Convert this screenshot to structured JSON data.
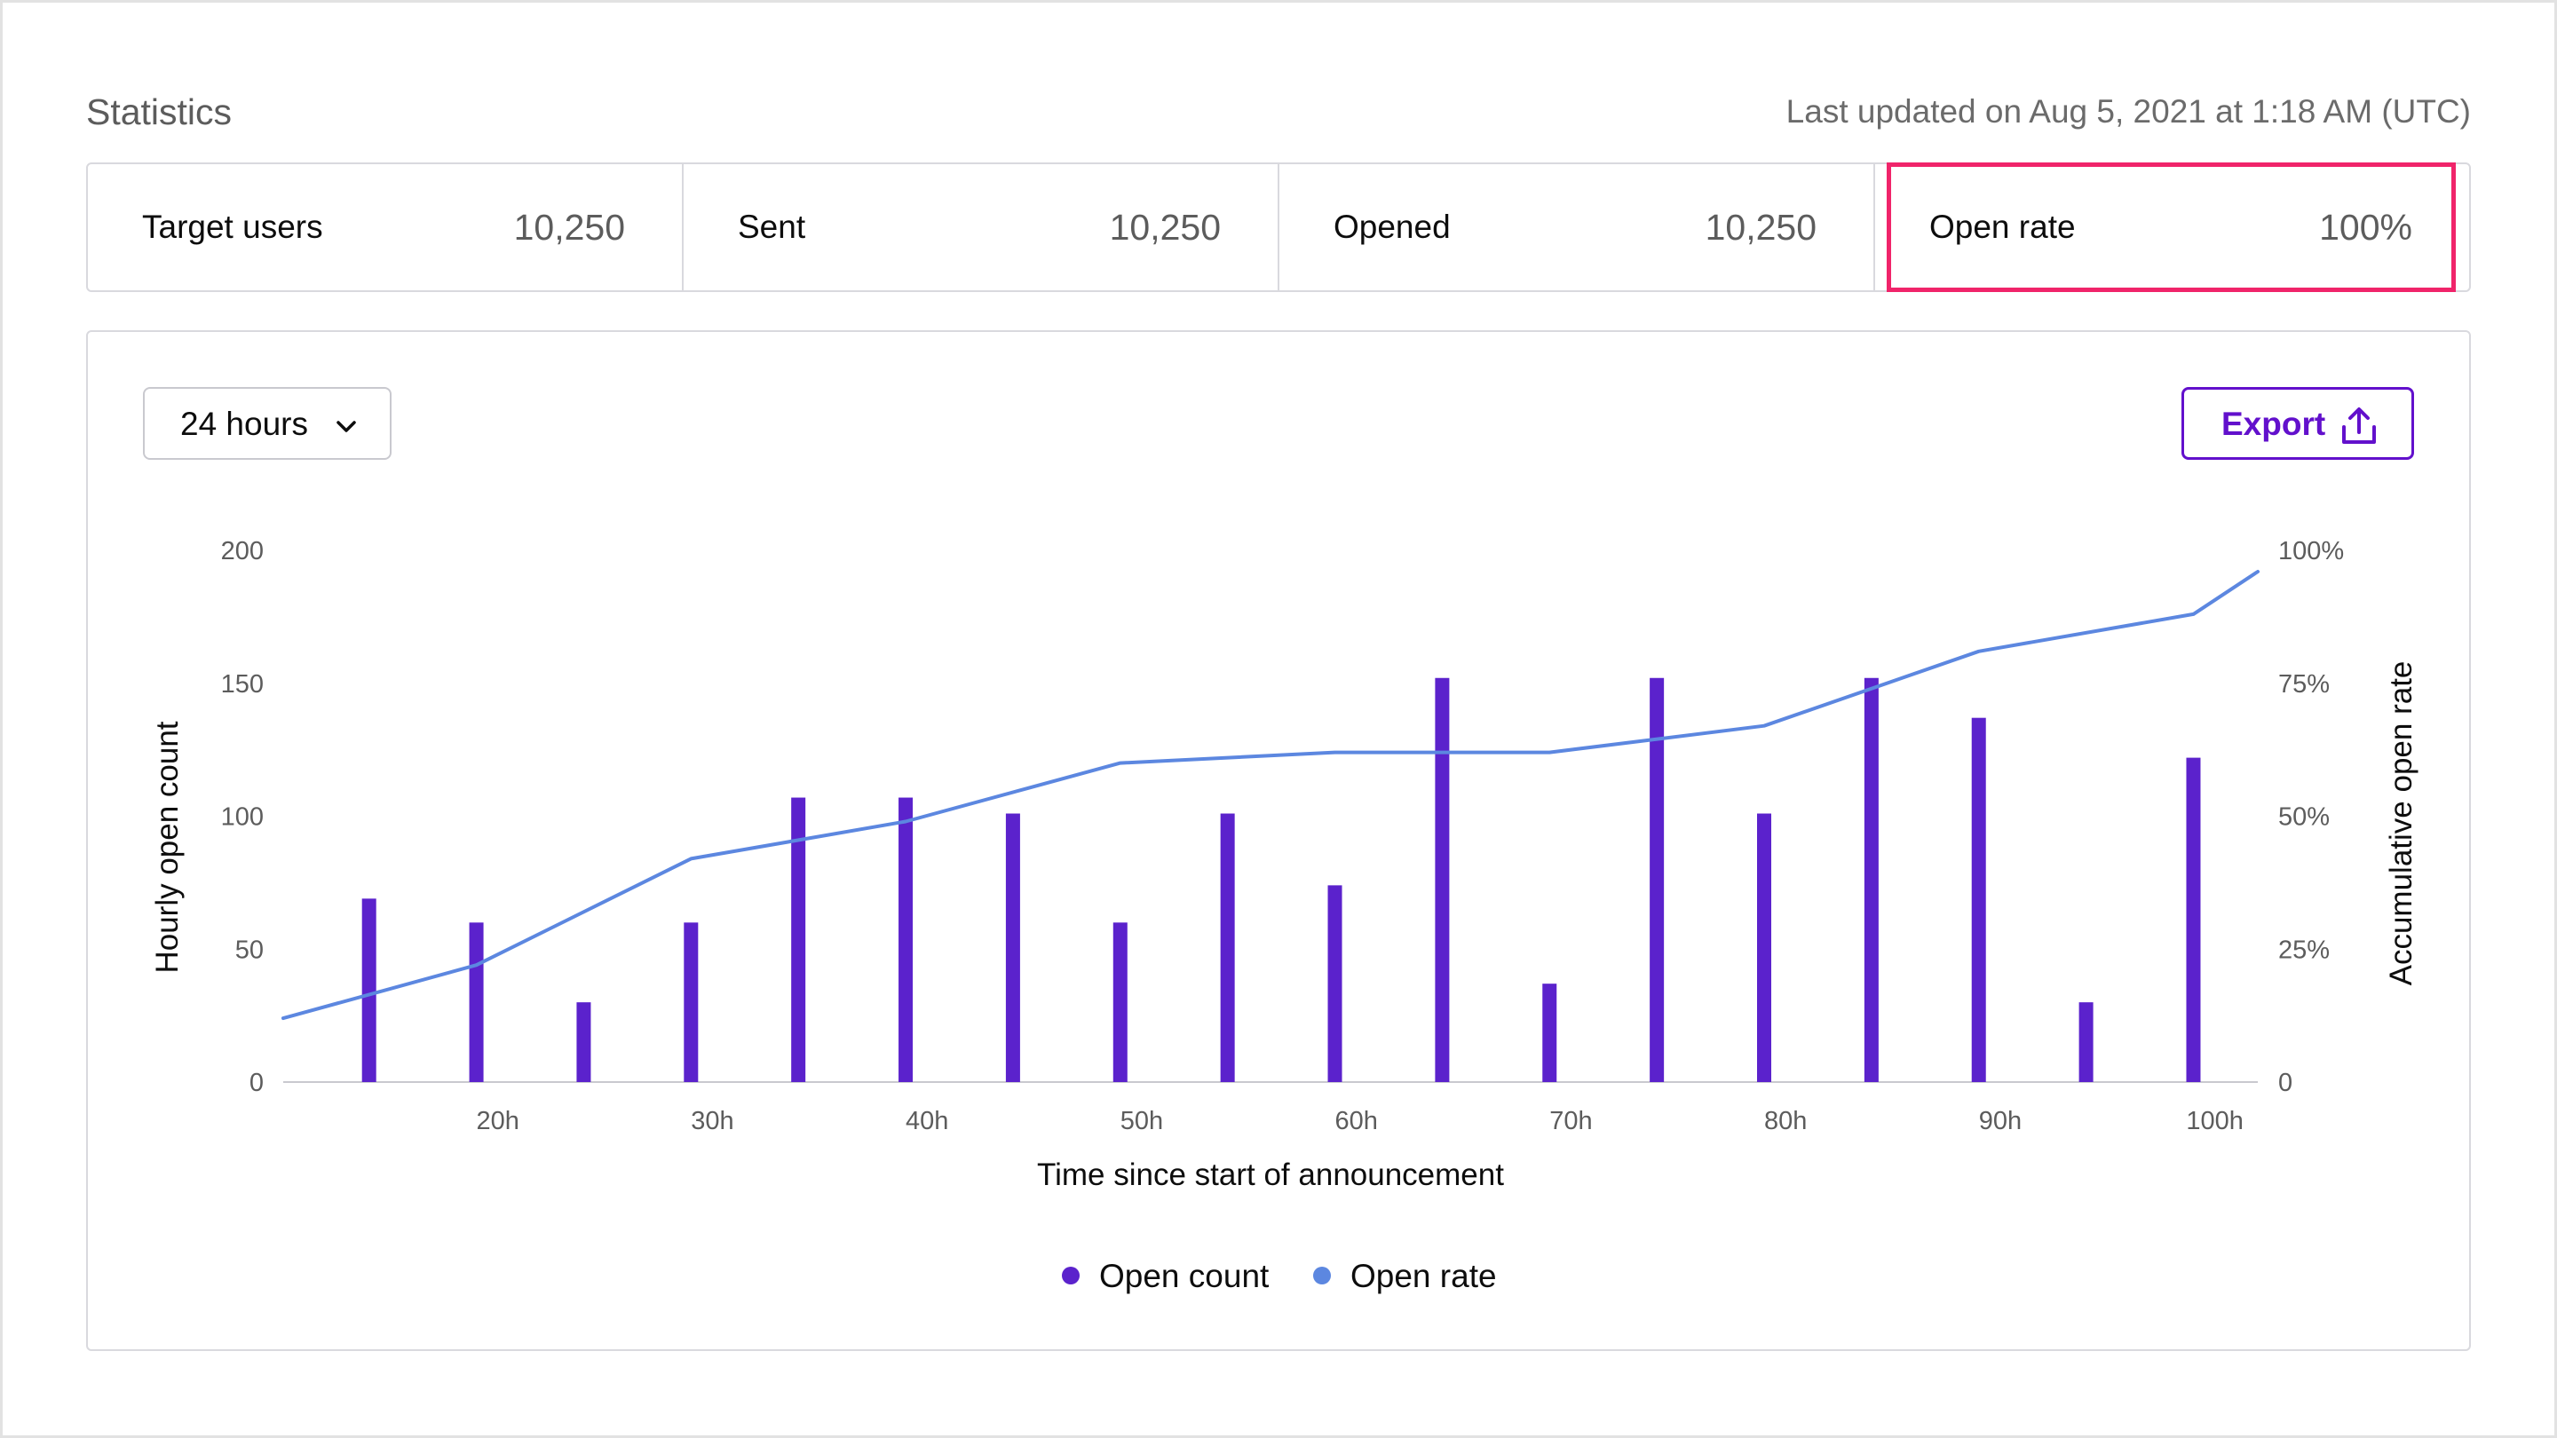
{
  "header": {
    "title": "Statistics",
    "last_updated": "Last updated on Aug 5, 2021 at 1:18 AM (UTC)"
  },
  "stats": [
    {
      "label": "Target users",
      "value": "10,250"
    },
    {
      "label": "Sent",
      "value": "10,250"
    },
    {
      "label": "Opened",
      "value": "10,250"
    },
    {
      "label": "Open rate",
      "value": "100%"
    }
  ],
  "highlight_color": "#f0246a",
  "controls": {
    "range_label": "24 hours",
    "range_icon": "chevron-down-icon",
    "export_label": "Export",
    "export_icon": "upload-icon"
  },
  "colors": {
    "bar": "#5b22cc",
    "line": "#5c87e0",
    "accent": "#6210cc"
  },
  "chart_data": {
    "type": "bar",
    "xlabel": "Time since start of announcement",
    "ylabel_left": "Hourly open count",
    "ylabel_right": "Accumulative open rate",
    "xlim": [
      10,
      102
    ],
    "x_ticks": [
      20,
      30,
      40,
      50,
      60,
      70,
      80,
      90,
      100
    ],
    "x_tick_labels": [
      "20h",
      "30h",
      "40h",
      "50h",
      "60h",
      "70h",
      "80h",
      "90h",
      "100h"
    ],
    "y_left_lim": [
      0,
      200
    ],
    "y_left_ticks": [
      "0",
      "50",
      "100",
      "150",
      "200"
    ],
    "y_right_lim": [
      0,
      100
    ],
    "y_right_ticks": [
      "0",
      "25%",
      "50%",
      "75%",
      "100%"
    ],
    "grid": false,
    "legend_position": "bottom-center",
    "series": [
      {
        "name": "Open count",
        "type": "bar",
        "axis": "left",
        "x": [
          14,
          19,
          24,
          29,
          34,
          39,
          44,
          49,
          54,
          59,
          64,
          69,
          74,
          79,
          84,
          89,
          94,
          99
        ],
        "values": [
          69,
          60,
          30,
          60,
          107,
          107,
          101,
          60,
          101,
          74,
          152,
          37,
          152,
          101,
          152,
          137,
          30,
          122
        ]
      },
      {
        "name": "Open rate",
        "type": "line",
        "axis": "right",
        "x": [
          10,
          19,
          29,
          39,
          49,
          59,
          69,
          79,
          89,
          99,
          102
        ],
        "values": [
          12,
          22,
          42,
          49,
          60,
          62,
          62,
          67,
          81,
          88,
          96
        ]
      }
    ]
  }
}
